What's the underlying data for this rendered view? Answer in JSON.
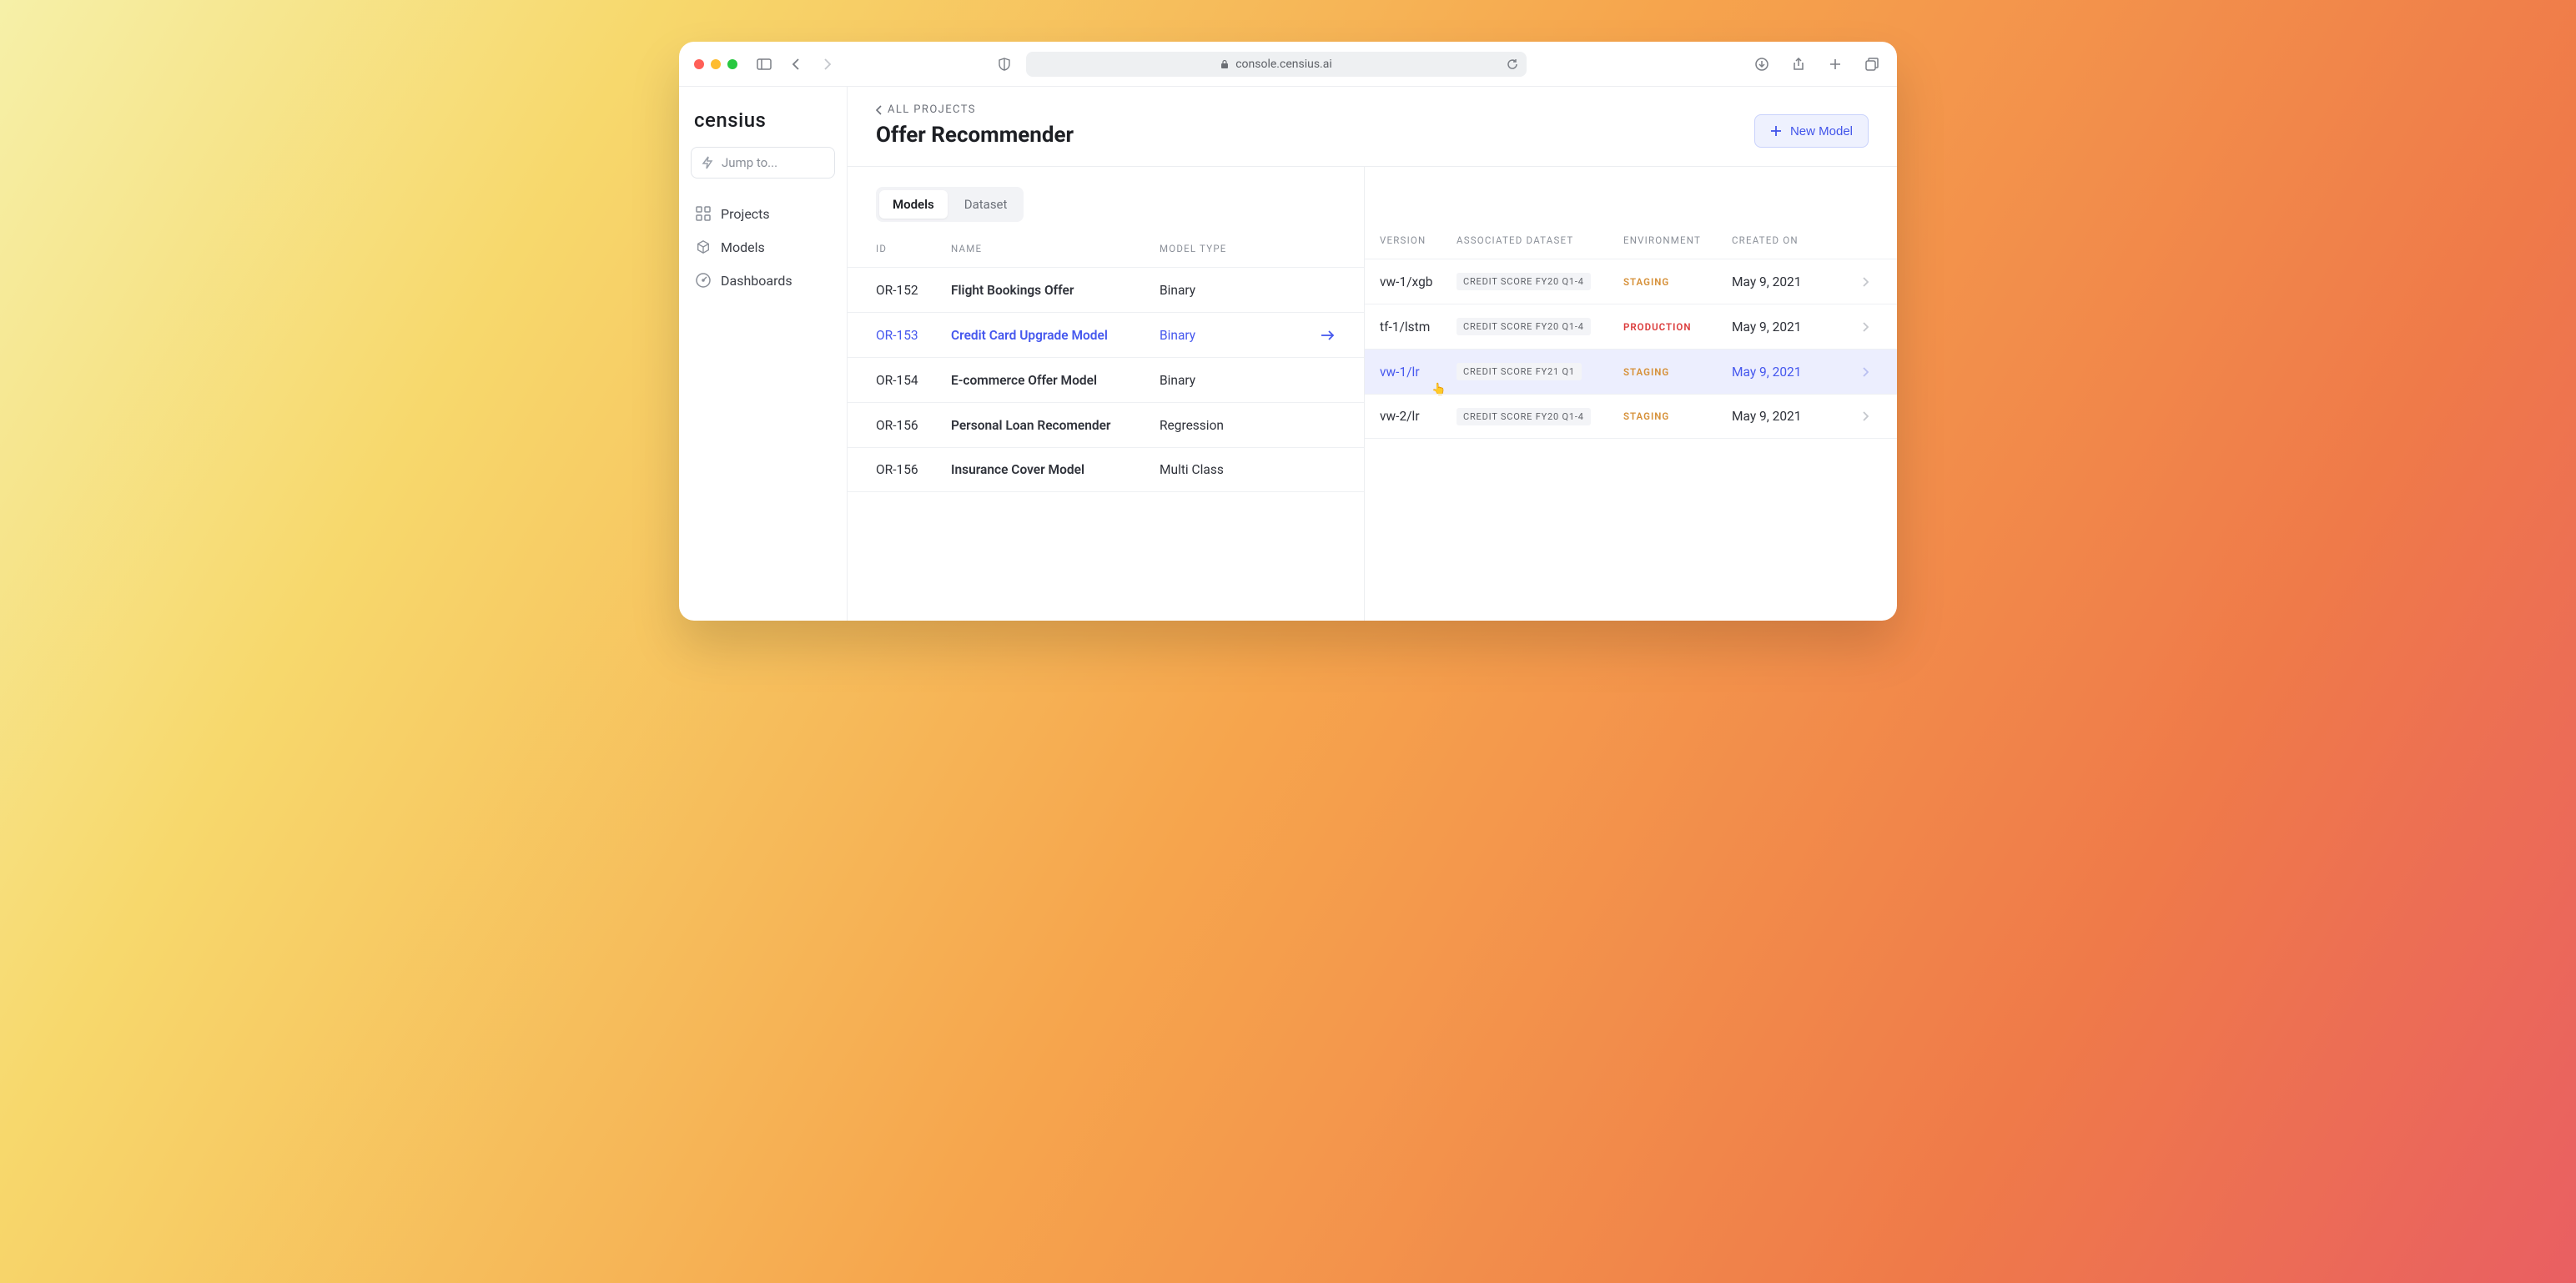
{
  "browser": {
    "url": "console.censius.ai"
  },
  "sidebar": {
    "logo": "censius",
    "jump_placeholder": "Jump to...",
    "nav": [
      {
        "label": "Projects"
      },
      {
        "label": "Models"
      },
      {
        "label": "Dashboards"
      }
    ]
  },
  "header": {
    "crumb": "ALL PROJECTS",
    "title": "Offer Recommender",
    "new_button": "New Model"
  },
  "tabs": [
    {
      "label": "Models",
      "active": true
    },
    {
      "label": "Dataset",
      "active": false
    }
  ],
  "models": {
    "columns": {
      "id": "ID",
      "name": "NAME",
      "type": "MODEL TYPE"
    },
    "rows": [
      {
        "id": "OR-152",
        "name": "Flight Bookings Offer",
        "type": "Binary",
        "selected": false
      },
      {
        "id": "OR-153",
        "name": "Credit Card Upgrade Model",
        "type": "Binary",
        "selected": true
      },
      {
        "id": "OR-154",
        "name": "E-commerce Offer Model",
        "type": "Binary",
        "selected": false
      },
      {
        "id": "OR-156",
        "name": "Personal Loan Recomender",
        "type": "Regression",
        "selected": false
      },
      {
        "id": "OR-156",
        "name": "Insurance Cover Model",
        "type": "Multi Class",
        "selected": false
      }
    ]
  },
  "versions": {
    "columns": {
      "version": "VERSION",
      "dataset": "ASSOCIATED DATASET",
      "env": "ENVIRONMENT",
      "created": "CREATED ON"
    },
    "rows": [
      {
        "version": "vw-1/xgb",
        "dataset": "CREDIT SCORE FY20 Q1-4",
        "env": "STAGING",
        "env_class": "staging",
        "created": "May 9, 2021",
        "hover": false
      },
      {
        "version": "tf-1/lstm",
        "dataset": "CREDIT SCORE FY20 Q1-4",
        "env": "PRODUCTION",
        "env_class": "production",
        "created": "May 9, 2021",
        "hover": false
      },
      {
        "version": "vw-1/lr",
        "dataset": "CREDIT SCORE FY21 Q1",
        "env": "STAGING",
        "env_class": "staging",
        "created": "May 9, 2021",
        "hover": true
      },
      {
        "version": "vw-2/lr",
        "dataset": "CREDIT SCORE FY20 Q1-4",
        "env": "STAGING",
        "env_class": "staging",
        "created": "May 9, 2021",
        "hover": false
      }
    ]
  }
}
